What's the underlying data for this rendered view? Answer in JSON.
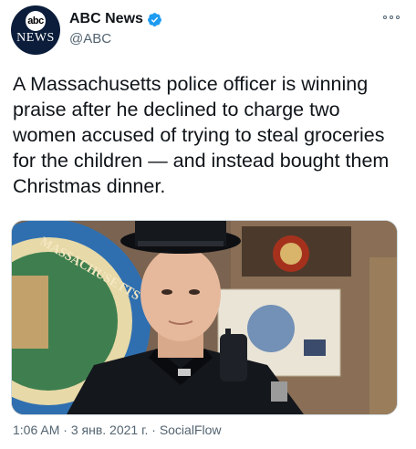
{
  "author": {
    "display_name": "ABC News",
    "handle": "@ABC",
    "verified": true,
    "avatar_logo_top": "abc",
    "avatar_logo_bottom": "NEWS"
  },
  "tweet": {
    "text": "A Massachusetts police officer is winning praise after he declined to charge two women accused of trying to steal groceries for the children — and instead bought them Christmas dinner.",
    "time": "1:06 AM",
    "separator": " · ",
    "date": "3 янв. 2021 г.",
    "source": "SocialFlow"
  },
  "media": {
    "seal_text": "MASSACHUSETTS",
    "alt": "photo of police officer"
  },
  "colors": {
    "verified": "#1d9bf0",
    "text": "#0f1419",
    "secondary": "#536471"
  }
}
